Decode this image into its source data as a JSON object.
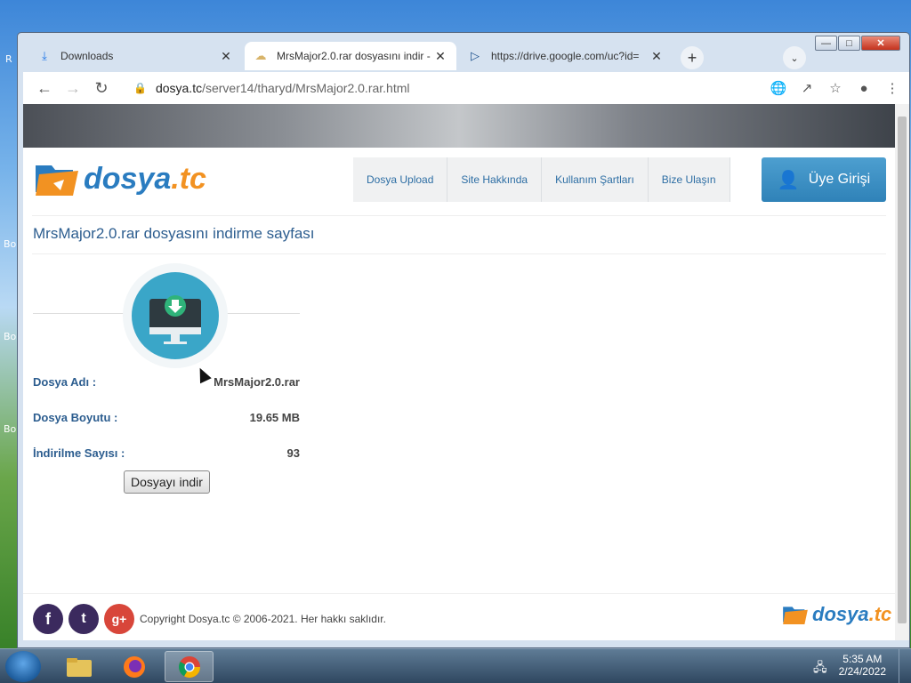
{
  "desktop": {
    "icon_labels": [
      "R",
      "Bo",
      "Bo",
      "Bo"
    ]
  },
  "browser": {
    "tabs": [
      {
        "title": "Downloads",
        "icon": "download-icon"
      },
      {
        "title": "MrsMajor2.0.rar dosyasını indir -",
        "icon": "dosya-favicon"
      },
      {
        "title": "https://drive.google.com/uc?id=",
        "icon": "drive-favicon"
      }
    ],
    "url": "dosya.tc/server14/tharyd/MrsMajor2.0.rar.html",
    "url_host": "dosya.tc",
    "url_path": "/server14/tharyd/MrsMajor2.0.rar.html"
  },
  "site": {
    "logo": {
      "part1": "dosya",
      "part2": ".tc"
    },
    "nav": [
      "Dosya Upload",
      "Site Hakkında",
      "Kullanım Şartları",
      "Bize Ulaşın"
    ],
    "login_label": "Üye Girişi",
    "page_title": "MrsMajor2.0.rar dosyasını indirme sayfası",
    "info": [
      {
        "label": "Dosya Adı :",
        "value": "MrsMajor2.0.rar"
      },
      {
        "label": "Dosya Boyutu :",
        "value": "19.65 MB"
      },
      {
        "label": "İndirilme Sayısı :",
        "value": "93"
      }
    ],
    "download_button": "Dosyayı indir",
    "copyright": "Copyright Dosya.tc © 2006-2021. Her hakkı saklıdır."
  },
  "taskbar": {
    "time": "5:35 AM",
    "date": "2/24/2022"
  },
  "colors": {
    "accent": "#2a7cc0",
    "orange": "#f29222",
    "title": "#2c5d8f",
    "download_circle": "#3aa6c8"
  }
}
